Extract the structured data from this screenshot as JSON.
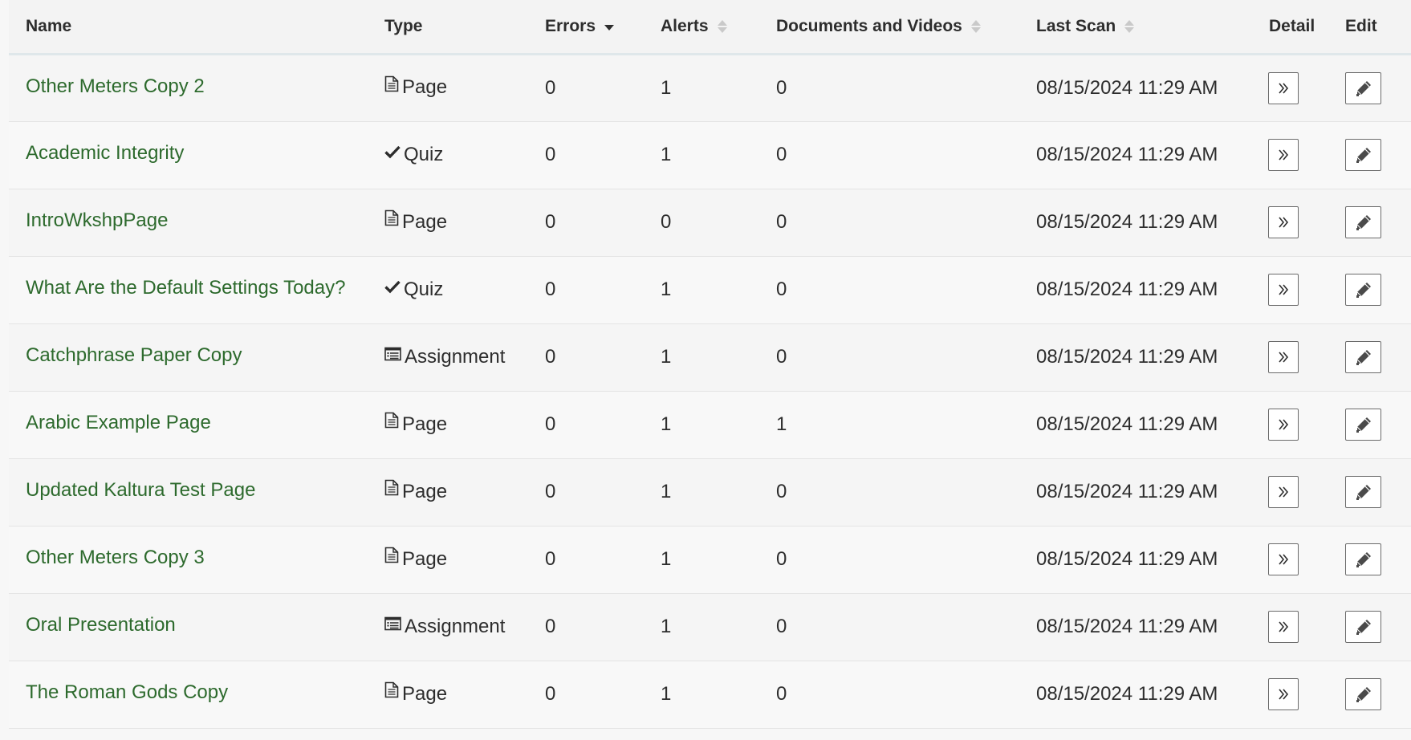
{
  "columns": {
    "name": "Name",
    "type": "Type",
    "errors": "Errors",
    "alerts": "Alerts",
    "docs": "Documents and Videos",
    "last_scan": "Last Scan",
    "detail": "Detail",
    "edit": "Edit"
  },
  "sort": {
    "column": "errors",
    "direction": "descending"
  },
  "colors": {
    "link": "#2d6a2d",
    "text": "#2d2d2d",
    "header_border": "#dfe7ea"
  },
  "rows": [
    {
      "name": "Other Meters Copy 2",
      "type": "Page",
      "type_icon": "document-icon",
      "errors": "0",
      "alerts": "1",
      "docs": "0",
      "last_scan": "08/15/2024 11:29 AM"
    },
    {
      "name": "Academic Integrity",
      "type": "Quiz",
      "type_icon": "checkmark-icon",
      "errors": "0",
      "alerts": "1",
      "docs": "0",
      "last_scan": "08/15/2024 11:29 AM"
    },
    {
      "name": "IntroWkshpPage",
      "type": "Page",
      "type_icon": "document-icon",
      "errors": "0",
      "alerts": "0",
      "docs": "0",
      "last_scan": "08/15/2024 11:29 AM"
    },
    {
      "name": "What Are the Default Settings Today?",
      "type": "Quiz",
      "type_icon": "checkmark-icon",
      "errors": "0",
      "alerts": "1",
      "docs": "0",
      "last_scan": "08/15/2024 11:29 AM"
    },
    {
      "name": "Catchphrase Paper Copy",
      "type": "Assignment",
      "type_icon": "list-alt-icon",
      "errors": "0",
      "alerts": "1",
      "docs": "0",
      "last_scan": "08/15/2024 11:29 AM"
    },
    {
      "name": "Arabic Example Page",
      "type": "Page",
      "type_icon": "document-icon",
      "errors": "0",
      "alerts": "1",
      "docs": "1",
      "last_scan": "08/15/2024 11:29 AM"
    },
    {
      "name": "Updated Kaltura Test Page",
      "type": "Page",
      "type_icon": "document-icon",
      "errors": "0",
      "alerts": "1",
      "docs": "0",
      "last_scan": "08/15/2024 11:29 AM"
    },
    {
      "name": "Other Meters Copy 3",
      "type": "Page",
      "type_icon": "document-icon",
      "errors": "0",
      "alerts": "1",
      "docs": "0",
      "last_scan": "08/15/2024 11:29 AM"
    },
    {
      "name": "Oral Presentation",
      "type": "Assignment",
      "type_icon": "list-alt-icon",
      "errors": "0",
      "alerts": "1",
      "docs": "0",
      "last_scan": "08/15/2024 11:29 AM"
    },
    {
      "name": "The Roman Gods Copy",
      "type": "Page",
      "type_icon": "document-icon",
      "errors": "0",
      "alerts": "1",
      "docs": "0",
      "last_scan": "08/15/2024 11:29 AM"
    }
  ]
}
